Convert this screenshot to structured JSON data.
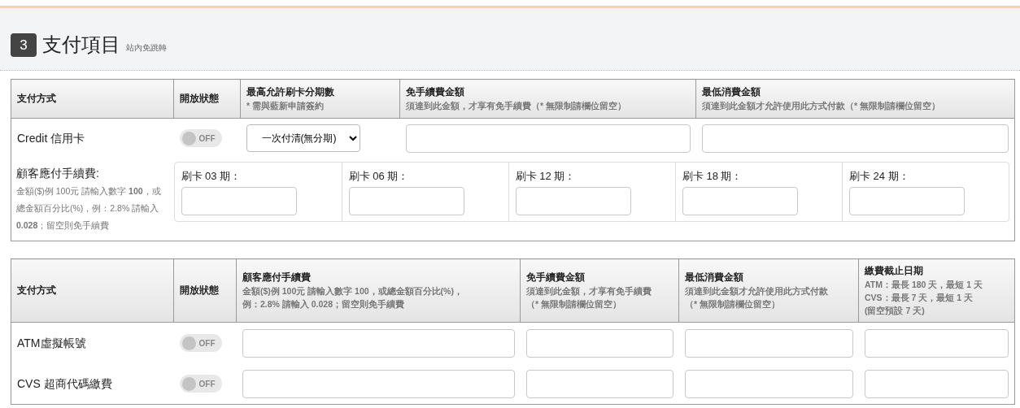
{
  "section": {
    "number": "3",
    "title": "支付項目",
    "subtitle": "站內免跳轉"
  },
  "credit_table": {
    "columns": [
      {
        "kind": "method",
        "title": "支付方式"
      },
      {
        "kind": "toggle",
        "title": "開放狀態"
      },
      {
        "kind": "select",
        "title": "最高允許刷卡分期數",
        "sub": [
          "* 需與藍新申請簽約"
        ]
      },
      {
        "kind": "input",
        "title": "免手續費金額",
        "sub": [
          "須達到此金額，才享有免手續費（* 無限制請欄位留空）"
        ]
      },
      {
        "kind": "input",
        "title": "最低消費金額",
        "sub": [
          "須達到此金額才允許使用此方式付款（* 無限制請欄位留空）"
        ]
      }
    ],
    "row": {
      "method": "Credit 信用卡",
      "toggle": {
        "on": false,
        "label": "OFF"
      },
      "select_value": "一次付清(無分期)"
    },
    "fee_row": {
      "label": "顧客應付手續費:",
      "note": "金額($)例 100元 請輸入數字 **100**，或總金額百分比(%)，例：2.8% 請輸入 **0.028**；留空則免手續費",
      "installments": [
        {
          "label": "刷卡 03 期："
        },
        {
          "label": "刷卡 06 期："
        },
        {
          "label": "刷卡 12 期："
        },
        {
          "label": "刷卡 18 期："
        },
        {
          "label": "刷卡 24 期："
        }
      ]
    }
  },
  "other_table": {
    "columns": [
      {
        "kind": "method",
        "title": "支付方式"
      },
      {
        "kind": "toggle",
        "title": "開放狀態"
      },
      {
        "kind": "input",
        "title": "顧客應付手續費",
        "sub": [
          "金額($)例 100元 請輸入數字 100，或總金額百分比(%)，",
          "例：2.8% 請輸入 0.028；留空則免手續費"
        ]
      },
      {
        "kind": "input",
        "title": "免手續費金額",
        "sub": [
          "須達到此金額，才享有免手續費",
          "（* 無限制請欄位留空）"
        ]
      },
      {
        "kind": "input",
        "title": "最低消費金額",
        "sub": [
          "須達到此金額才允許使用此方式付款",
          "（* 無限制請欄位留空）"
        ]
      },
      {
        "kind": "input",
        "title": "繳費截止日期",
        "sub": [
          "ATM：最長 180 天，最短 1 天",
          "CVS：最長 7 天，最短 1 天",
          "(留空預設 7 天)"
        ]
      }
    ],
    "rows": [
      {
        "method": "ATM虛擬帳號",
        "toggle": {
          "on": false,
          "label": "OFF"
        }
      },
      {
        "method": "CVS 超商代碼繳費",
        "toggle": {
          "on": false,
          "label": "OFF"
        }
      }
    ]
  }
}
